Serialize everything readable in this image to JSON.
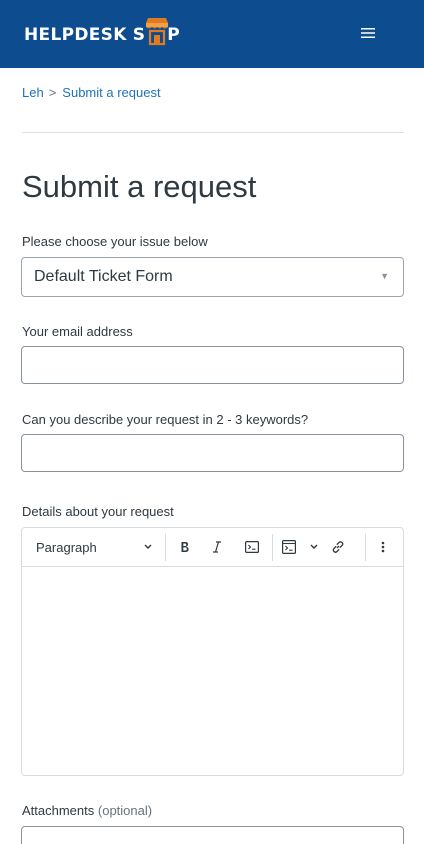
{
  "header": {
    "logo_left": "HELPDESK",
    "logo_s": "S",
    "logo_p": "P",
    "menu_icon": "hamburger-menu-icon"
  },
  "breadcrumb": {
    "items": [
      "Leh",
      "Submit a request"
    ],
    "separator": ">"
  },
  "page": {
    "title": "Submit a request"
  },
  "form": {
    "issue_label": "Please choose your issue below",
    "issue_value": "Default Ticket Form",
    "email_label": "Your email address",
    "email_value": "",
    "subject_label": "Can you describe your request in 2 - 3 keywords?",
    "subject_value": "",
    "details_label": "Details about your request",
    "attachments_label": "Attachments",
    "attachments_optional": "(optional)"
  },
  "editor": {
    "block_format": "Paragraph",
    "tools": [
      "bold-icon",
      "italic-icon",
      "code-icon",
      "code-block-icon",
      "link-icon",
      "more-icon"
    ]
  },
  "colors": {
    "header_bg": "#0d4d8f",
    "link": "#1f73b7",
    "logo_accent": "#e07b1f"
  }
}
